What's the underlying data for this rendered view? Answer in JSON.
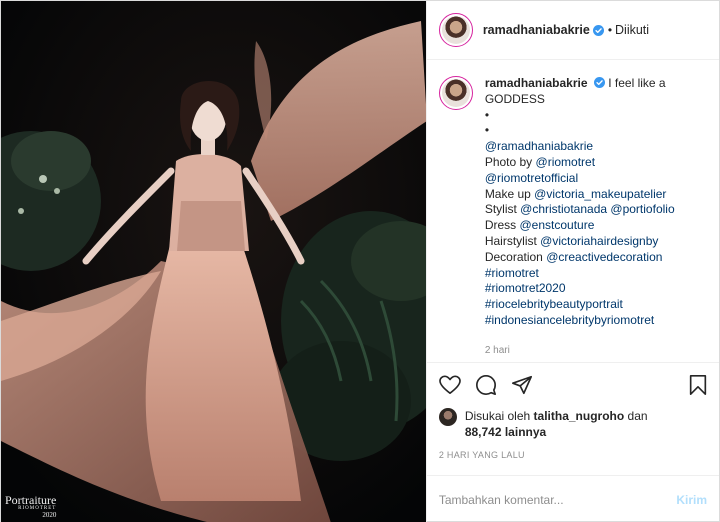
{
  "post": {
    "image_alt": "Woman in flowing blush tulle gown surrounded by dark foliage",
    "watermark": {
      "main": "Portraiture",
      "sub": "RIOMOTRET",
      "year": "2020"
    }
  },
  "header": {
    "username": "ramadhaniabakrie",
    "separator": "•",
    "follow_status": "Diikuti"
  },
  "caption": {
    "username": "ramadhaniabakrie",
    "first_line": "I feel like a GODDESS",
    "lines": [
      {
        "text": "•",
        "kind": "plain"
      },
      {
        "text": "•",
        "kind": "plain"
      },
      {
        "text": "@ramadhaniabakrie",
        "kind": "tag"
      }
    ],
    "credits": [
      {
        "label": "Photo by ",
        "tags": [
          "@riomotret"
        ]
      },
      {
        "label": "",
        "tags": [
          "@riomotretofficial"
        ]
      },
      {
        "label": "Make up ",
        "tags": [
          "@victoria_makeupatelier"
        ]
      },
      {
        "label": "Stylist ",
        "tags": [
          "@christiotanada",
          "@portiofolio"
        ]
      },
      {
        "label": "Dress ",
        "tags": [
          "@enstcouture"
        ]
      },
      {
        "label": "Hairstylist ",
        "tags": [
          "@victoriahairdesignby"
        ]
      },
      {
        "label": "Decoration ",
        "tags": [
          "@creactivedecoration"
        ]
      }
    ],
    "hashtags": [
      "#riomotret",
      "#riomotret2020",
      "#riocelebritybeautyportrait",
      "#indonesiancelebritybyriomotret"
    ],
    "time": "2 hari"
  },
  "actions": {
    "like": "heart-icon",
    "comment": "comment-icon",
    "share": "share-icon",
    "save": "bookmark-icon"
  },
  "likes": {
    "prefix": "Disukai oleh",
    "user": "talitha_nugroho",
    "joiner": "dan",
    "count": "88,742 lainnya"
  },
  "timestamp": "2 HARI YANG LALU",
  "comment": {
    "placeholder": "Tambahkan komentar...",
    "post_label": "Kirim"
  },
  "colors": {
    "verified": "#3897f0",
    "link": "#00376b",
    "muted": "#8e8e8e",
    "post_button_disabled": "#b2dffc",
    "story_ring": "#d6249f"
  }
}
